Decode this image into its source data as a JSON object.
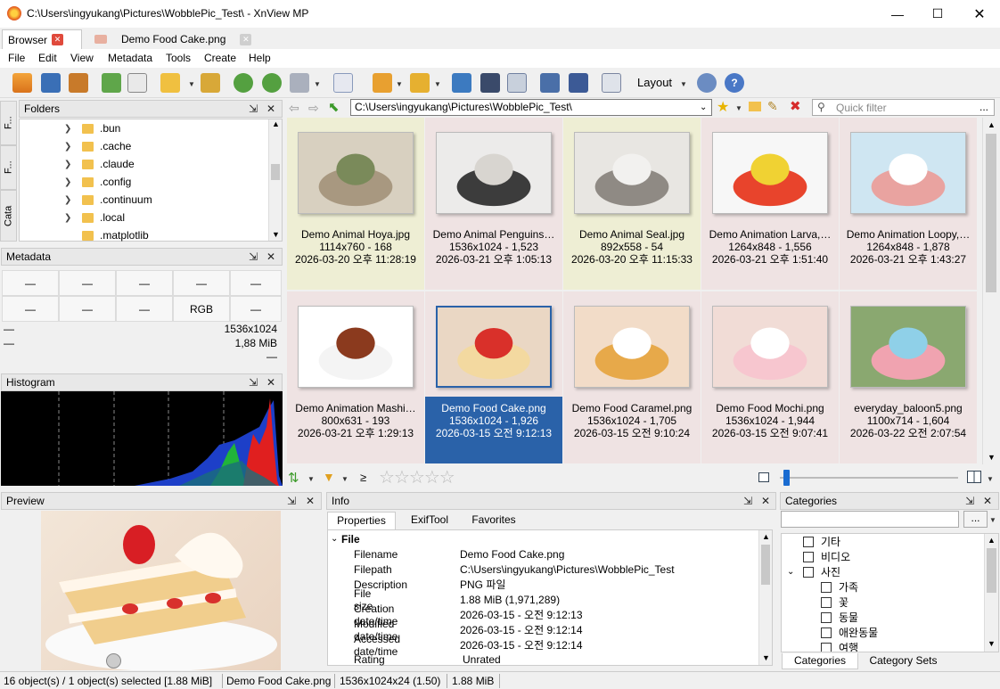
{
  "window": {
    "title": "C:\\Users\\ingyukang\\Pictures\\WobblePic_Test\\ - XnView MP"
  },
  "tabs": [
    {
      "label": "Browser"
    },
    {
      "label": "Demo Food Cake.png"
    }
  ],
  "menu": [
    "File",
    "Edit",
    "View",
    "Metadata",
    "Tools",
    "Create",
    "Help"
  ],
  "toolbar": {
    "layout_label": "Layout"
  },
  "folders": {
    "title": "Folders",
    "items": [
      ".bun",
      ".cache",
      ".claude",
      ".config",
      ".continuum",
      ".local",
      ".matplotlib"
    ]
  },
  "sidetabs": [
    "F...",
    "F...",
    "Cata"
  ],
  "metadata": {
    "title": "Metadata",
    "row1": [
      "—",
      "—",
      "—",
      "—",
      "—"
    ],
    "row2": [
      "—",
      "—",
      "—",
      "RGB",
      "—"
    ],
    "lines": [
      {
        "left": "—",
        "right": "1536x1024"
      },
      {
        "left": "—",
        "right": "1,88 MiB"
      },
      {
        "left": "",
        "right": "—"
      }
    ]
  },
  "histogram": {
    "title": "Histogram"
  },
  "address": {
    "path": "C:\\Users\\ingyukang\\Pictures\\WobblePic_Test\\",
    "filter_placeholder": "Quick filter",
    "more": "..."
  },
  "thumbnails": [
    {
      "name": "Demo Animal Hoya.jpg",
      "info": "1114x760 - 168",
      "date": "2026-03-20 오후 11:28:19",
      "bg": "#eeeed4",
      "colors": [
        "#d8d0c0",
        "#a89880",
        "#7a8a5a"
      ]
    },
    {
      "name": "Demo Animal Penguins…",
      "info": "1536x1024 - 1,523",
      "date": "2026-03-21 오후 1:05:13",
      "bg": "#efe3e3",
      "colors": [
        "#ecebea",
        "#3c3c3c",
        "#d8d5d0"
      ]
    },
    {
      "name": "Demo Animal Seal.jpg",
      "info": "892x558 - 54",
      "date": "2026-03-20 오후 11:15:33",
      "bg": "#eeeed4",
      "colors": [
        "#e8e6e2",
        "#8f8a84",
        "#f2f1ef"
      ]
    },
    {
      "name": "Demo Animation Larva,…",
      "info": "1264x848 - 1,556",
      "date": "2026-03-21 오후 1:51:40",
      "bg": "#efe3e3",
      "colors": [
        "#f7f7f7",
        "#e8442c",
        "#f0d233"
      ]
    },
    {
      "name": "Demo Animation Loopy,…",
      "info": "1264x848 - 1,878",
      "date": "2026-03-21 오후 1:43:27",
      "bg": "#efe3e3",
      "colors": [
        "#cfe6f2",
        "#e9a3a0",
        "#ffffff"
      ]
    },
    {
      "name": "Demo Animation Mashi…",
      "info": "800x631 - 193",
      "date": "2026-03-21 오후 1:29:13",
      "bg": "#efe3e3",
      "colors": [
        "#ffffff",
        "#f4f4f4",
        "#8b3a1e"
      ]
    },
    {
      "name": "Demo Food Cake.png",
      "info": "1536x1024 - 1,926",
      "date": "2026-03-15 오전 9:12:13",
      "bg": "#2a62a9",
      "colors": [
        "#ead7c4",
        "#f3d9a0",
        "#d9302a"
      ]
    },
    {
      "name": "Demo Food Caramel.png",
      "info": "1536x1024 - 1,705",
      "date": "2026-03-15 오전 9:10:24",
      "bg": "#efe3e3",
      "colors": [
        "#f2dcc8",
        "#e7a94a",
        "#ffffff"
      ]
    },
    {
      "name": "Demo Food Mochi.png",
      "info": "1536x1024 - 1,944",
      "date": "2026-03-15 오전 9:07:41",
      "bg": "#efe3e3",
      "colors": [
        "#f1dcd6",
        "#f7c6cf",
        "#ffffff"
      ]
    },
    {
      "name": "everyday_baloon5.png",
      "info": "1100x714 - 1,604",
      "date": "2026-03-22 오전 2:07:54",
      "bg": "#efe3e3",
      "colors": [
        "#8aa870",
        "#f0a3b0",
        "#8fd0e8"
      ]
    }
  ],
  "filterbar": {
    "ge": "≥"
  },
  "preview": {
    "title": "Preview"
  },
  "info": {
    "title": "Info",
    "tabs": [
      "Properties",
      "ExifTool",
      "Favorites"
    ],
    "group": "File",
    "rows": [
      {
        "label": "Filename",
        "value": "Demo Food Cake.png"
      },
      {
        "label": "Filepath",
        "value": "C:\\Users\\ingyukang\\Pictures\\WobblePic_Test"
      },
      {
        "label": "Description",
        "value": "PNG 파일"
      },
      {
        "label": "File size",
        "value": "1.88 MiB (1,971,289)"
      },
      {
        "label": "Creation date/time",
        "value": "2026-03-15 - 오전 9:12:13"
      },
      {
        "label": "Modified date/time",
        "value": "2026-03-15 - 오전 9:12:14"
      },
      {
        "label": "Accessed date/time",
        "value": "2026-03-15 - 오전 9:12:14"
      },
      {
        "label": "Rating",
        "value": "Unrated"
      }
    ]
  },
  "categories": {
    "title": "Categories",
    "more": "...",
    "items": [
      {
        "label": "기타",
        "level": 0,
        "expand": false
      },
      {
        "label": "비디오",
        "level": 0,
        "expand": false
      },
      {
        "label": "사진",
        "level": 0,
        "expand": true
      },
      {
        "label": "가족",
        "level": 1,
        "expand": false
      },
      {
        "label": "꽃",
        "level": 1,
        "expand": false
      },
      {
        "label": "동물",
        "level": 1,
        "expand": false
      },
      {
        "label": "애완동물",
        "level": 1,
        "expand": false
      },
      {
        "label": "여행",
        "level": 1,
        "expand": false
      }
    ],
    "tabs": [
      "Categories",
      "Category Sets"
    ]
  },
  "status": {
    "objects": "16 object(s) / 1 object(s) selected [1.88 MiB]",
    "file": "Demo Food Cake.png",
    "dims": "1536x1024x24 (1.50)",
    "size": "1.88 MiB"
  },
  "colors": {
    "accent": "#2a62a9",
    "tab_close": "#e04a3c"
  }
}
